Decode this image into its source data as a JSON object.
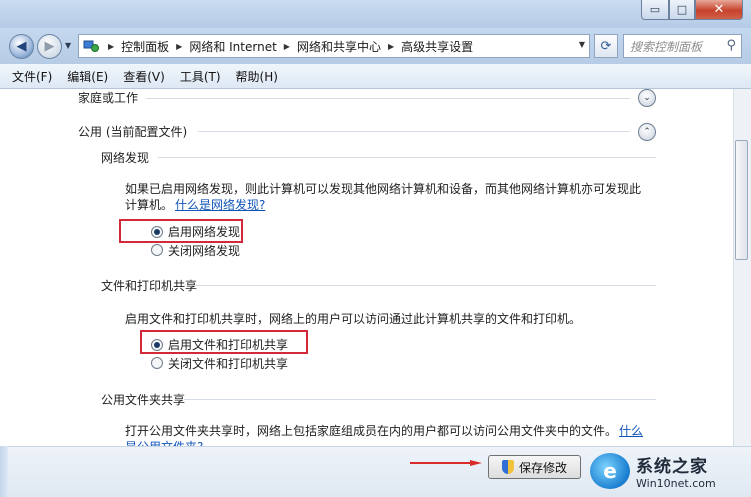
{
  "window": {
    "controls": {
      "minimize": "▭",
      "maximize": "□",
      "close": "✕"
    }
  },
  "nav": {
    "back_icon": "◀",
    "forward_icon": "▶",
    "breadcrumb": [
      "控制面板",
      "网络和 Internet",
      "网络和共享中心",
      "高级共享设置"
    ],
    "search_placeholder": "搜索控制面板"
  },
  "menu": [
    "文件(F)",
    "编辑(E)",
    "查看(V)",
    "工具(T)",
    "帮助(H)"
  ],
  "profiles": {
    "home_work": "家庭或工作",
    "public": "公用 (当前配置文件)"
  },
  "network_discovery": {
    "title": "网络发现",
    "desc_line1": "如果已启用网络发现，则此计算机可以发现其他网络计算机和设备，而其他网络计算机亦可发现此",
    "desc_line2": "计算机。",
    "link": "什么是网络发现?",
    "options": [
      "启用网络发现",
      "关闭网络发现"
    ],
    "selected": 0
  },
  "file_printer_sharing": {
    "title": "文件和打印机共享",
    "desc": "启用文件和打印机共享时，网络上的用户可以访问通过此计算机共享的文件和打印机。",
    "options": [
      "启用文件和打印机共享",
      "关闭文件和打印机共享"
    ],
    "selected": 0
  },
  "public_folder_sharing": {
    "title": "公用文件夹共享",
    "desc": "打开公用文件夹共享时，网络上包括家庭组成员在内的用户都可以访问公用文件夹中的文件。",
    "link_line1": "什么",
    "link_line2": "是公用文件夹?"
  },
  "footer": {
    "save_button": "保存修改"
  },
  "watermark": {
    "logo_char": "e",
    "title": "系统之家",
    "url": "Win10net.com"
  },
  "colors": {
    "highlight_box": "#d32a3a",
    "link": "#1155bb",
    "titlebar": "#b5cbe6"
  }
}
